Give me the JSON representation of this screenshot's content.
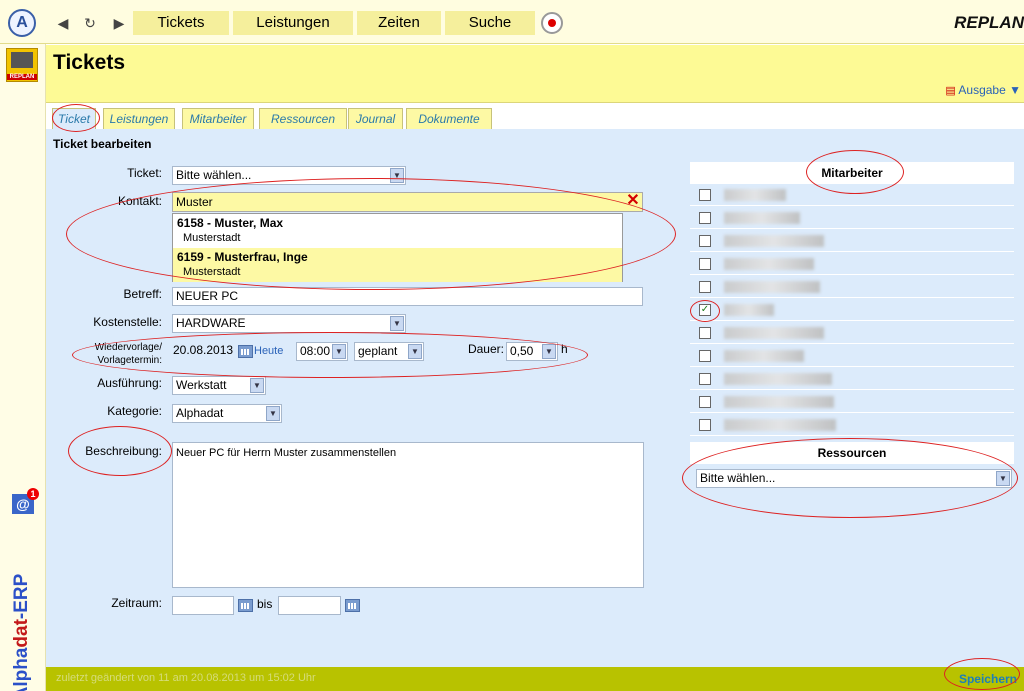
{
  "topbar": {
    "logo_letter": "A",
    "nav": {
      "back": "◀",
      "reload": "↻",
      "forward": "▶"
    },
    "menu": [
      "Tickets",
      "Leistungen",
      "Zeiten",
      "Suche"
    ],
    "brand": "REPLAN"
  },
  "sidebar": {
    "replan_icon_text": "REPLAN",
    "mail_badge": "1",
    "vertical_brand_a": "Alpha",
    "vertical_brand_b": "dat",
    "vertical_brand_c": "-ERP"
  },
  "header": {
    "title": "Tickets",
    "ausgabe": "Ausgabe ▼"
  },
  "tabs": [
    {
      "label": "Ticket",
      "active": true
    },
    {
      "label": "Leistungen"
    },
    {
      "label": "Mitarbeiter"
    },
    {
      "label": "Ressourcen"
    },
    {
      "label": "Journal"
    },
    {
      "label": "Dokumente"
    }
  ],
  "form": {
    "section_title": "Ticket bearbeiten",
    "ticket_label": "Ticket:",
    "ticket_value": "Bitte wählen...",
    "kontakt_label": "Kontakt:",
    "kontakt_value": "Muster",
    "suggestions": [
      {
        "title": "6158 - Muster, Max",
        "city": "Musterstadt"
      },
      {
        "title": "6159 - Musterfrau, Inge",
        "city": "Musterstadt"
      }
    ],
    "betreff_label": "Betreff:",
    "betreff_value": "NEUER PC",
    "kostenstelle_label": "Kostenstelle:",
    "kostenstelle_value": "HARDWARE",
    "wiedervorlage_label_1": "Wiedervorlage/",
    "wiedervorlage_label_2": "Vorlagetermin:",
    "date_value": "20.08.2013",
    "heute": "Heute",
    "time_value": "08:00",
    "status_value": "geplant",
    "dauer_label": "Dauer:",
    "dauer_value": "0,50",
    "dauer_unit": "h",
    "ausfuehrung_label": "Ausführung:",
    "ausfuehrung_value": "Werkstatt",
    "kategorie_label": "Kategorie:",
    "kategorie_value": "Alphadat",
    "beschreibung_label": "Beschreibung:",
    "beschreibung_value": "Neuer PC für Herrn Muster zusammenstellen",
    "zeitraum_label": "Zeitraum:",
    "bis": "bis"
  },
  "mitarbeiter": {
    "title": "Mitarbeiter",
    "rows": [
      false,
      false,
      false,
      false,
      false,
      true,
      false,
      false,
      false,
      false,
      false
    ]
  },
  "ressourcen": {
    "title": "Ressourcen",
    "value": "Bitte wählen..."
  },
  "footer": {
    "status": "zuletzt geändert von 11 am 20.08.2013 um 15:02 Uhr",
    "save": "Speichern"
  },
  "colors": {
    "accent_yellow": "#fdfa95",
    "content_blue": "#dcebfb",
    "footer_green": "#b8c200",
    "annotation_red": "#d22"
  }
}
